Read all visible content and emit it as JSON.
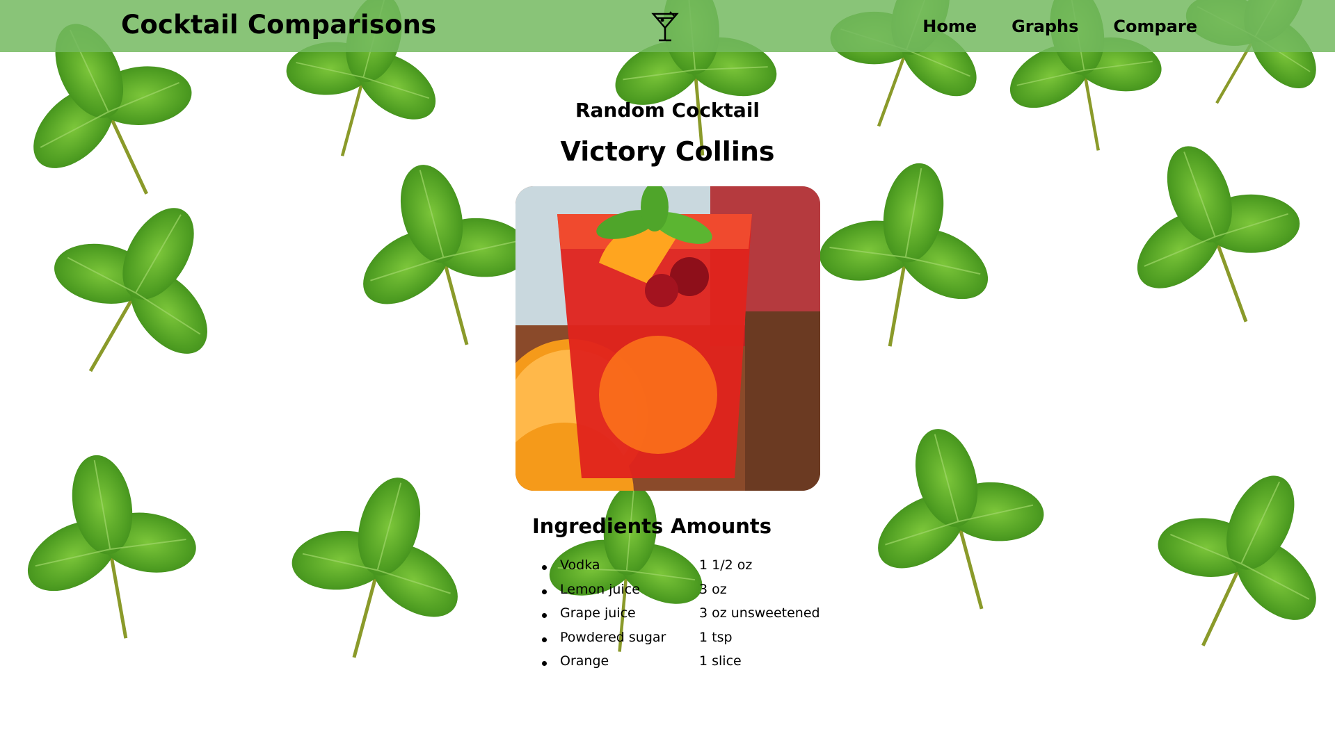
{
  "navbar": {
    "brand": "Cocktail Comparisons",
    "logo_icon": "martini-glass-icon",
    "background_color": "#74ba60",
    "links": [
      "Home",
      "Graphs",
      "Compare"
    ]
  },
  "main": {
    "subtitle": "Random Cocktail",
    "cocktail_name": "Victory Collins",
    "photo_icon": "red-cocktail-photo",
    "table": {
      "headers": [
        "Ingredients",
        "Amounts"
      ],
      "rows": [
        {
          "ingredient": "Vodka",
          "amount": "1 1/2 oz"
        },
        {
          "ingredient": "Lemon juice",
          "amount": "3 oz"
        },
        {
          "ingredient": "Grape juice",
          "amount": "3 oz unsweetened"
        },
        {
          "ingredient": "Powdered sugar",
          "amount": "1 tsp"
        },
        {
          "ingredient": "Orange",
          "amount": "1 slice"
        }
      ]
    }
  },
  "background": {
    "pattern": "mint-leaves",
    "leaf_color": "#5aa82a",
    "leaf_dark_color": "#3d8a1a"
  }
}
